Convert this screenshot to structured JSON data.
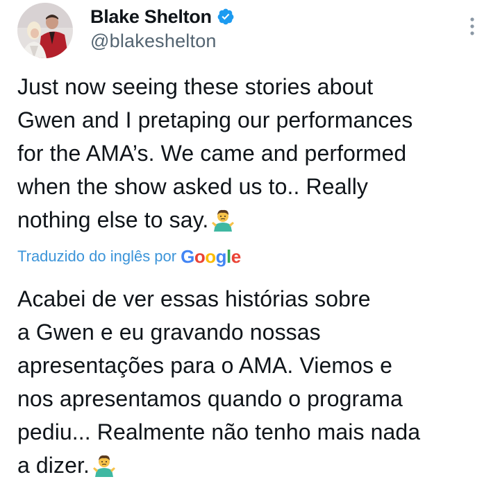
{
  "author": {
    "display_name": "Blake Shelton",
    "handle": "@blakeshelton",
    "verified": true
  },
  "icons": {
    "verified": "verified-badge-icon",
    "more": "more-options-icon",
    "emoji": "person-shrugging-emoji"
  },
  "tweet": {
    "original_lines": [
      "Just now seeing these stories about",
      "Gwen and I pretaping our performances",
      "for the AMA’s. We came and performed",
      "when the show asked us to.. Really",
      "nothing else to say."
    ],
    "translation_label": "Traduzido do inglês por",
    "translation_provider": "Google",
    "translated_lines": [
      "Acabei de ver essas histórias sobre",
      "a Gwen e eu gravando nossas",
      "apresentações para o AMA. Viemos e",
      "nos apresentamos quando o programa",
      "pediu... Realmente não tenho mais nada",
      "a dizer."
    ]
  },
  "colors": {
    "text": "#0f1419",
    "secondary": "#536471",
    "translation_link": "#3b94d9",
    "verified": "#1d9bf0",
    "google_blue": "#4285f4",
    "google_red": "#ea4335",
    "google_yellow": "#fbbc05",
    "google_green": "#34a853"
  }
}
